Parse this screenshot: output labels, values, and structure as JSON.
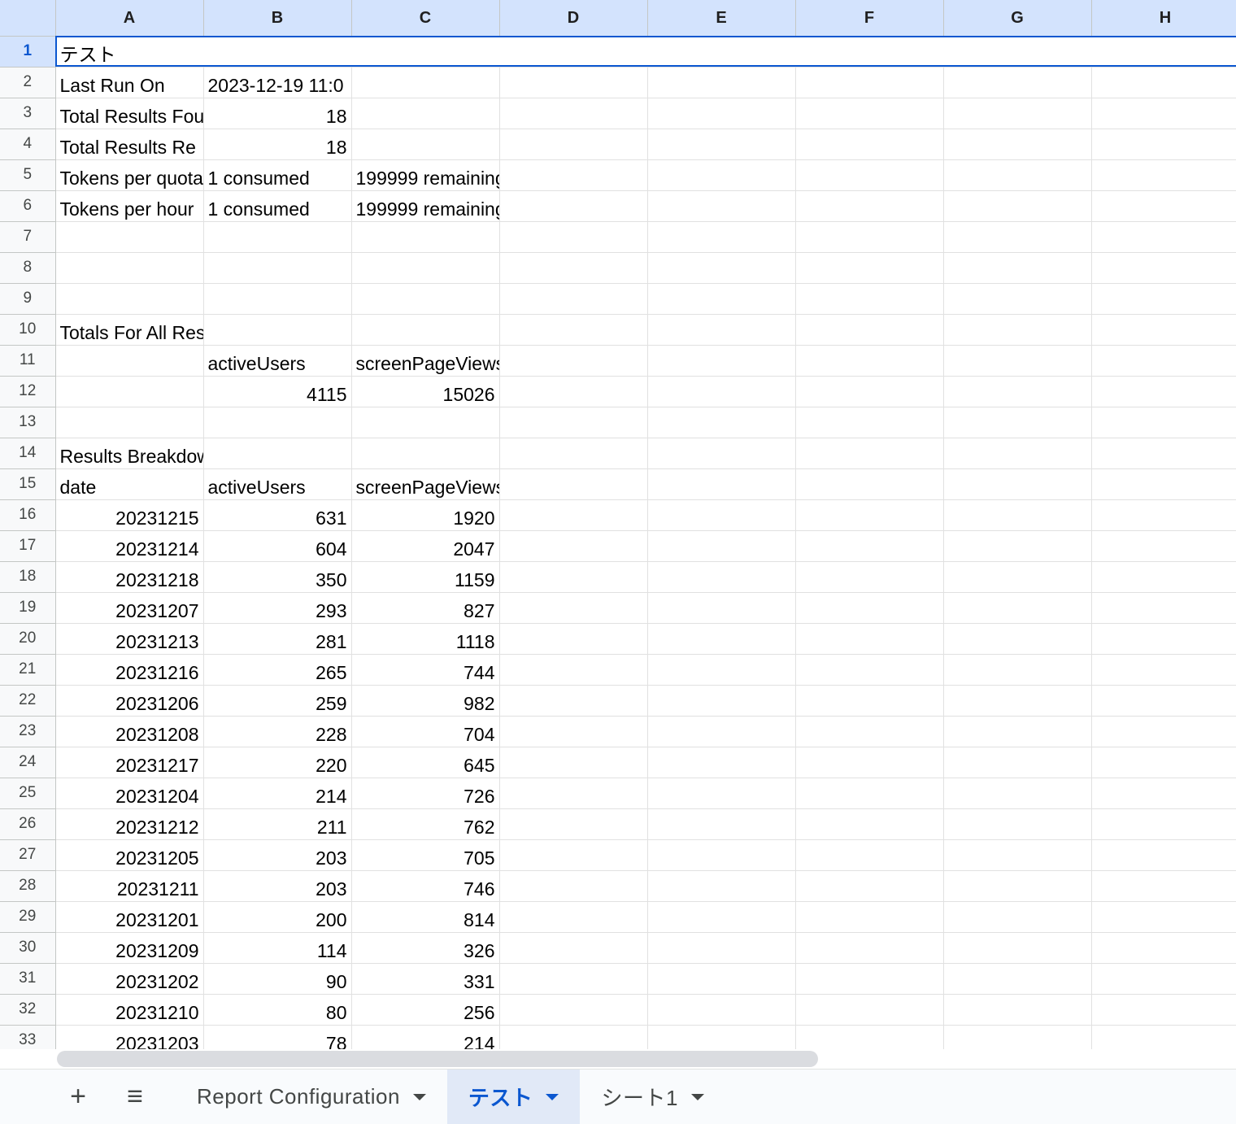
{
  "columns": [
    "A",
    "B",
    "C",
    "D",
    "E",
    "F",
    "G",
    "H"
  ],
  "rows": [
    {
      "n": "1",
      "c": [
        "テスト",
        "",
        "",
        "",
        "",
        "",
        "",
        ""
      ]
    },
    {
      "n": "2",
      "c": [
        "Last Run On",
        "2023-12-19 11:0",
        "",
        "",
        "",
        "",
        "",
        ""
      ]
    },
    {
      "n": "3",
      "c": [
        "Total Results Fou",
        "18",
        "",
        "",
        "",
        "",
        "",
        ""
      ]
    },
    {
      "n": "4",
      "c": [
        "Total Results Re",
        "18",
        "",
        "",
        "",
        "",
        "",
        ""
      ]
    },
    {
      "n": "5",
      "c": [
        "Tokens per quota",
        "1 consumed",
        "199999 remaining",
        "",
        "",
        "",
        "",
        ""
      ]
    },
    {
      "n": "6",
      "c": [
        "Tokens per hour",
        "1 consumed",
        "199999 remaining",
        "",
        "",
        "",
        "",
        ""
      ]
    },
    {
      "n": "7",
      "c": [
        "",
        "",
        "",
        "",
        "",
        "",
        "",
        ""
      ]
    },
    {
      "n": "8",
      "c": [
        "",
        "",
        "",
        "",
        "",
        "",
        "",
        ""
      ]
    },
    {
      "n": "9",
      "c": [
        "",
        "",
        "",
        "",
        "",
        "",
        "",
        ""
      ]
    },
    {
      "n": "10",
      "c": [
        "Totals For All Results",
        "",
        "",
        "",
        "",
        "",
        "",
        ""
      ]
    },
    {
      "n": "11",
      "c": [
        "",
        "activeUsers",
        "screenPageViews",
        "",
        "",
        "",
        "",
        ""
      ]
    },
    {
      "n": "12",
      "c": [
        "",
        "4115",
        "15026",
        "",
        "",
        "",
        "",
        ""
      ]
    },
    {
      "n": "13",
      "c": [
        "",
        "",
        "",
        "",
        "",
        "",
        "",
        ""
      ]
    },
    {
      "n": "14",
      "c": [
        "Results Breakdown",
        "",
        "",
        "",
        "",
        "",
        "",
        ""
      ]
    },
    {
      "n": "15",
      "c": [
        "date",
        "activeUsers",
        "screenPageViews",
        "",
        "",
        "",
        "",
        ""
      ]
    },
    {
      "n": "16",
      "c": [
        "20231215",
        "631",
        "1920",
        "",
        "",
        "",
        "",
        ""
      ]
    },
    {
      "n": "17",
      "c": [
        "20231214",
        "604",
        "2047",
        "",
        "",
        "",
        "",
        ""
      ]
    },
    {
      "n": "18",
      "c": [
        "20231218",
        "350",
        "1159",
        "",
        "",
        "",
        "",
        ""
      ]
    },
    {
      "n": "19",
      "c": [
        "20231207",
        "293",
        "827",
        "",
        "",
        "",
        "",
        ""
      ]
    },
    {
      "n": "20",
      "c": [
        "20231213",
        "281",
        "1118",
        "",
        "",
        "",
        "",
        ""
      ]
    },
    {
      "n": "21",
      "c": [
        "20231216",
        "265",
        "744",
        "",
        "",
        "",
        "",
        ""
      ]
    },
    {
      "n": "22",
      "c": [
        "20231206",
        "259",
        "982",
        "",
        "",
        "",
        "",
        ""
      ]
    },
    {
      "n": "23",
      "c": [
        "20231208",
        "228",
        "704",
        "",
        "",
        "",
        "",
        ""
      ]
    },
    {
      "n": "24",
      "c": [
        "20231217",
        "220",
        "645",
        "",
        "",
        "",
        "",
        ""
      ]
    },
    {
      "n": "25",
      "c": [
        "20231204",
        "214",
        "726",
        "",
        "",
        "",
        "",
        ""
      ]
    },
    {
      "n": "26",
      "c": [
        "20231212",
        "211",
        "762",
        "",
        "",
        "",
        "",
        ""
      ]
    },
    {
      "n": "27",
      "c": [
        "20231205",
        "203",
        "705",
        "",
        "",
        "",
        "",
        ""
      ]
    },
    {
      "n": "28",
      "c": [
        "20231211",
        "203",
        "746",
        "",
        "",
        "",
        "",
        ""
      ]
    },
    {
      "n": "29",
      "c": [
        "20231201",
        "200",
        "814",
        "",
        "",
        "",
        "",
        ""
      ]
    },
    {
      "n": "30",
      "c": [
        "20231209",
        "114",
        "326",
        "",
        "",
        "",
        "",
        ""
      ]
    },
    {
      "n": "31",
      "c": [
        "20231202",
        "90",
        "331",
        "",
        "",
        "",
        "",
        ""
      ]
    },
    {
      "n": "32",
      "c": [
        "20231210",
        "80",
        "256",
        "",
        "",
        "",
        "",
        ""
      ]
    },
    {
      "n": "33",
      "c": [
        "20231203",
        "78",
        "214",
        "",
        "",
        "",
        "",
        ""
      ]
    }
  ],
  "tabbar": {
    "add_icon": "+",
    "menu_icon": "≡",
    "tabs": [
      {
        "label": "Report Configuration"
      },
      {
        "label": "テスト"
      },
      {
        "label": "シート1"
      }
    ]
  },
  "colors": {
    "accent": "#0b57d0",
    "header_bg": "#d3e3fd"
  }
}
